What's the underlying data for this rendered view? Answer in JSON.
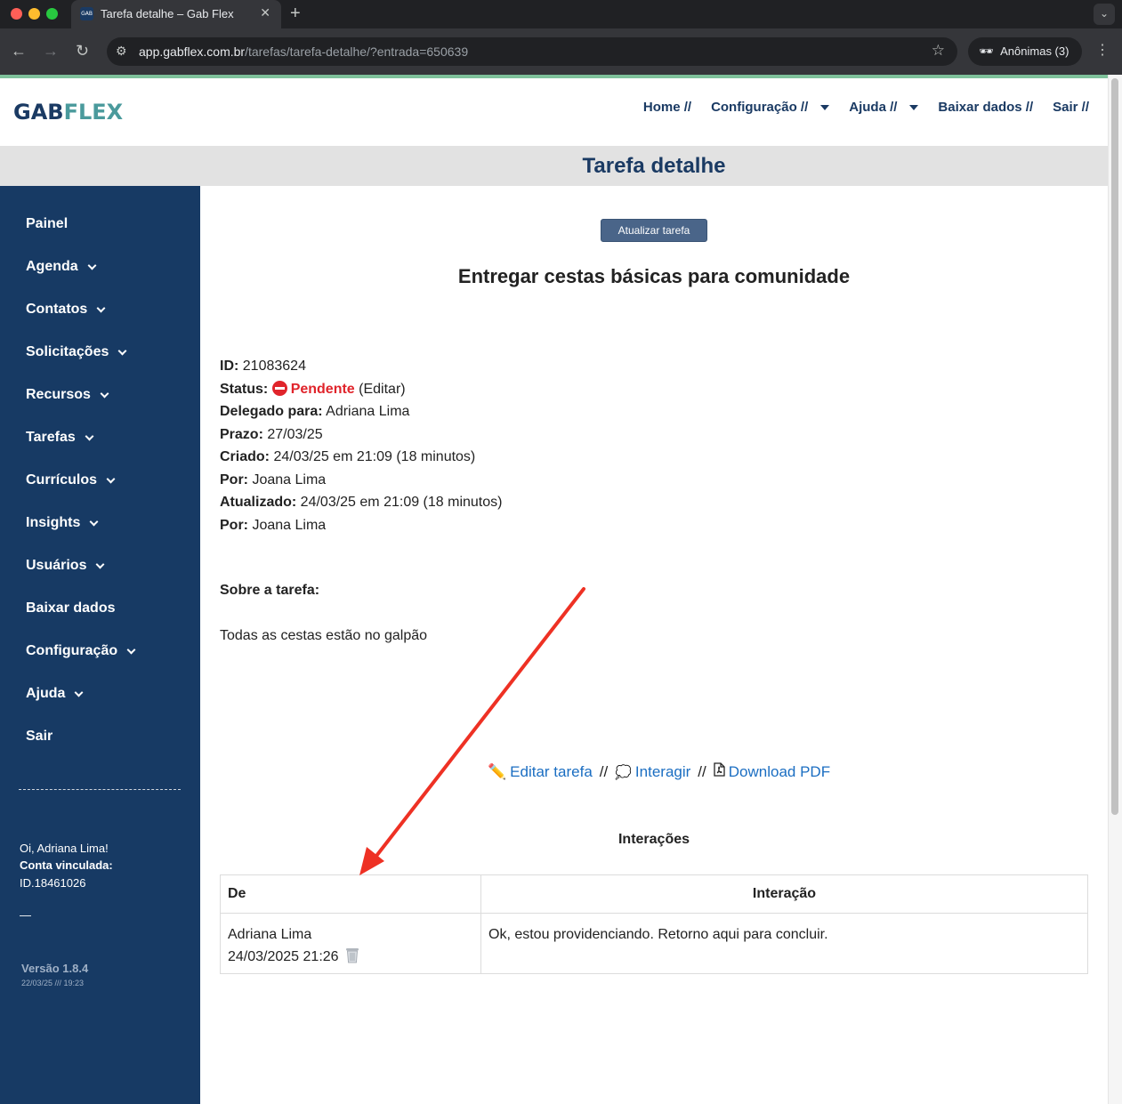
{
  "browser": {
    "tab_title": "Tarefa detalhe – Gab Flex",
    "favicon_text": "GAB",
    "url_host": "app.gabflex.com.br",
    "url_path": "/tarefas/tarefa-detalhe/?entrada=650639",
    "profile_label": "Anônimas (3)"
  },
  "header": {
    "logo_part1": "GAB",
    "logo_part2": "FLEX",
    "nav": {
      "home": "Home //",
      "config": "Configuração //",
      "help": "Ajuda //",
      "download": "Baixar dados //",
      "logout": "Sair //"
    },
    "page_title": "Tarefa detalhe"
  },
  "sidebar": {
    "items": [
      {
        "label": "Painel"
      },
      {
        "label": "Agenda"
      },
      {
        "label": "Contatos"
      },
      {
        "label": "Solicitações"
      },
      {
        "label": "Recursos"
      },
      {
        "label": "Tarefas"
      },
      {
        "label": "Currículos"
      },
      {
        "label": "Insights"
      },
      {
        "label": "Usuários"
      },
      {
        "label": "Baixar dados"
      },
      {
        "label": "Configuração"
      },
      {
        "label": "Ajuda"
      },
      {
        "label": "Sair"
      }
    ],
    "greeting": "Oi, Adriana Lima!",
    "linked_label": "Conta vinculada:",
    "linked_id": "ID.18461026",
    "dash": "—",
    "version": "Versão 1.8.4",
    "version_date": "22/03/25 /// 19:23"
  },
  "task": {
    "update_button": "Atualizar tarefa",
    "title": "Entregar cestas básicas para comunidade",
    "id_label": "ID:",
    "id_value": "21083624",
    "status_label": "Status:",
    "status_value": "Pendente",
    "status_edit": "(Editar)",
    "delegated_label": "Delegado para:",
    "delegated_value": "Adriana Lima",
    "deadline_label": "Prazo:",
    "deadline_value": "27/03/25",
    "created_label": "Criado:",
    "created_value": "24/03/25 em 21:09 (18 minutos)",
    "created_by_label": "Por:",
    "created_by_value": "Joana Lima",
    "updated_label": "Atualizado:",
    "updated_value": "24/03/25 em 21:09 (18 minutos)",
    "updated_by_label": "Por:",
    "updated_by_value": "Joana Lima",
    "about_label": "Sobre a tarefa:",
    "about_text": "Todas as cestas estão no galpão",
    "status_color": "#e0242b"
  },
  "actions": {
    "edit": "Editar tarefa",
    "interact": "Interagir",
    "pdf": "Download PDF",
    "sep": "//"
  },
  "interactions": {
    "title": "Interações",
    "col_from": "De",
    "col_interaction": "Interação",
    "rows": [
      {
        "from_name": "Adriana Lima",
        "from_date": "24/03/2025 21:26",
        "text": "Ok, estou providenciando. Retorno aqui para concluir."
      }
    ]
  },
  "colors": {
    "primary": "#173a64",
    "accent_green": "#7fc29b",
    "link": "#1b6ec2",
    "annotation_arrow": "#ee3124"
  }
}
